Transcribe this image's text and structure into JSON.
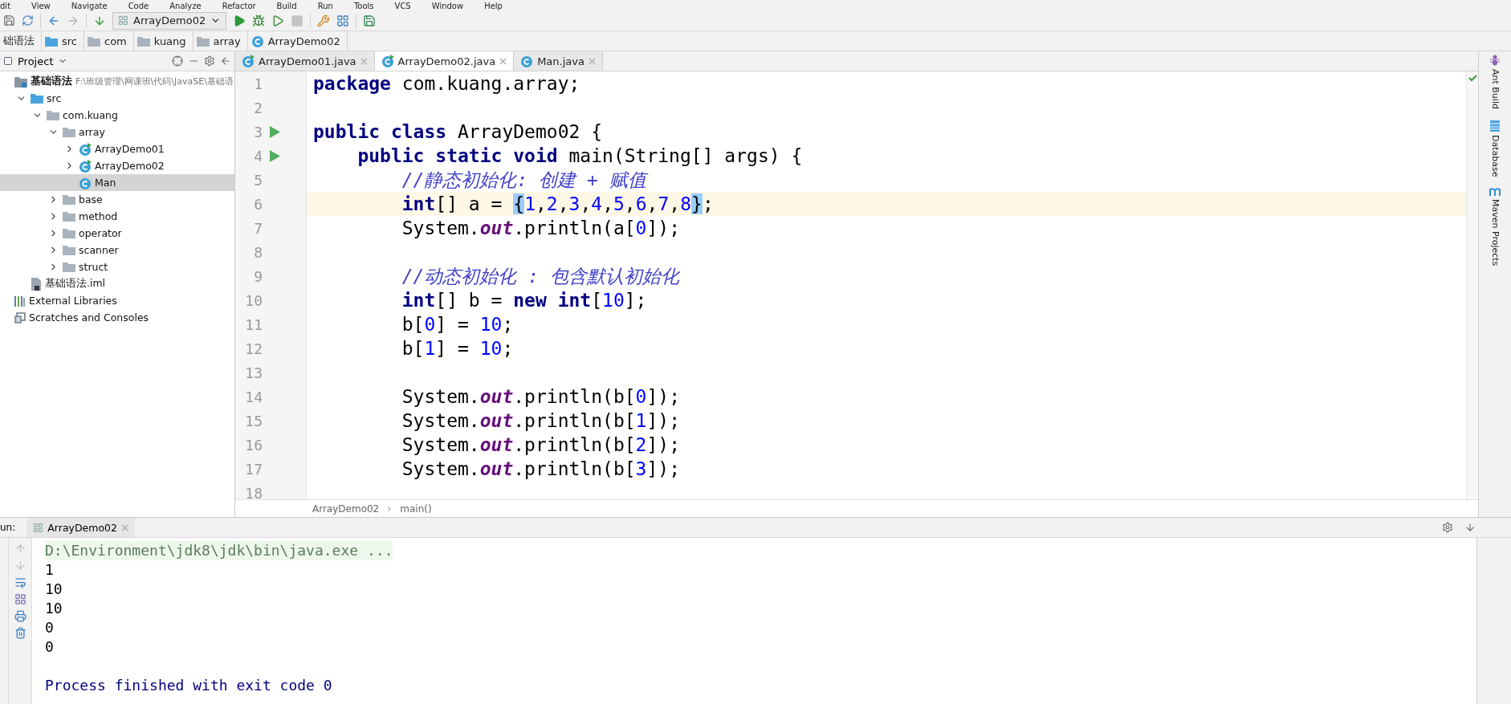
{
  "menu": [
    "dit",
    "View",
    "Navigate",
    "Code",
    "Analyze",
    "Refactor",
    "Build",
    "Run",
    "Tools",
    "VCS",
    "Window",
    "Help"
  ],
  "toolbar": {
    "run_config": "ArrayDemo02"
  },
  "breadcrumb": [
    {
      "label": "础语法"
    },
    {
      "label": "src",
      "kind": "source"
    },
    {
      "label": "com",
      "kind": "folder"
    },
    {
      "label": "kuang",
      "kind": "folder"
    },
    {
      "label": "array",
      "kind": "folder"
    },
    {
      "label": "ArrayDemo02",
      "kind": "class"
    }
  ],
  "project": {
    "title": "Project",
    "tree": [
      {
        "label": "基础语法",
        "path": "F:\\班级管理\\网课班\\代码\\JavaSE\\基础语",
        "kind": "module",
        "selected": false,
        "children": [
          {
            "label": "src",
            "kind": "source",
            "expanded": true,
            "selected": false,
            "children": [
              {
                "label": "com.kuang",
                "kind": "folder",
                "expanded": true,
                "selected": false,
                "children": [
                  {
                    "label": "array",
                    "kind": "folder",
                    "expanded": true,
                    "selected": false,
                    "children": [
                      {
                        "label": "ArrayDemo01",
                        "kind": "runclass",
                        "expanded": false,
                        "selected": false
                      },
                      {
                        "label": "ArrayDemo02",
                        "kind": "runclass",
                        "expanded": false,
                        "selected": false
                      },
                      {
                        "label": "Man",
                        "kind": "class",
                        "selected": true
                      }
                    ]
                  },
                  {
                    "label": "base",
                    "kind": "folder",
                    "expanded": false,
                    "selected": false
                  },
                  {
                    "label": "method",
                    "kind": "folder",
                    "expanded": false,
                    "selected": false
                  },
                  {
                    "label": "operator",
                    "kind": "folder",
                    "expanded": false,
                    "selected": false
                  },
                  {
                    "label": "scanner",
                    "kind": "folder",
                    "expanded": false,
                    "selected": false
                  },
                  {
                    "label": "struct",
                    "kind": "folder",
                    "expanded": false,
                    "selected": false
                  }
                ]
              }
            ]
          },
          {
            "label": "基础语法.iml",
            "kind": "file",
            "selected": false
          }
        ]
      },
      {
        "label": "External Libraries",
        "kind": "libraries",
        "selected": false
      },
      {
        "label": "Scratches and Consoles",
        "kind": "scratches",
        "selected": false
      }
    ]
  },
  "tabs": [
    {
      "label": "ArrayDemo01.java",
      "kind": "runclass",
      "selected": false
    },
    {
      "label": "ArrayDemo02.java",
      "kind": "runclass",
      "selected": true
    },
    {
      "label": "Man.java",
      "kind": "class",
      "selected": false
    }
  ],
  "code": [
    {
      "number": "1",
      "current": false,
      "run_marker": false,
      "tokens": [
        {
          "kind": "kw",
          "text": "package"
        },
        {
          "kind": "plain",
          "text": " com.kuang.array;"
        }
      ]
    },
    {
      "number": "2",
      "current": false,
      "run_marker": false
    },
    {
      "number": "3",
      "current": false,
      "run_marker": true,
      "tokens": [
        {
          "kind": "kw",
          "text": "public class"
        },
        {
          "kind": "plain",
          "text": " ArrayDemo02 {"
        }
      ]
    },
    {
      "number": "4",
      "current": false,
      "run_marker": true,
      "tokens": [
        {
          "kind": "kw",
          "text": "    public static void"
        },
        {
          "kind": "plain",
          "text": " main(String[] args) {"
        }
      ]
    },
    {
      "number": "5",
      "current": false,
      "run_marker": false,
      "tokens": [
        {
          "kind": "comment",
          "text": "        //静态初始化: 创建 + 赋值"
        }
      ]
    },
    {
      "number": "6",
      "current": true,
      "run_marker": false,
      "tokens": [
        {
          "kind": "kw",
          "text": "        int"
        },
        {
          "kind": "plain",
          "text": "[] a = "
        },
        {
          "kind": "brace",
          "text": "{"
        },
        {
          "kind": "num",
          "text": "1"
        },
        {
          "kind": "plain",
          "text": ","
        },
        {
          "kind": "num",
          "text": "2"
        },
        {
          "kind": "plain",
          "text": ","
        },
        {
          "kind": "num",
          "text": "3"
        },
        {
          "kind": "plain",
          "text": ","
        },
        {
          "kind": "num",
          "text": "4"
        },
        {
          "kind": "plain",
          "text": ","
        },
        {
          "kind": "num",
          "text": "5"
        },
        {
          "kind": "plain",
          "text": ","
        },
        {
          "kind": "num",
          "text": "6"
        },
        {
          "kind": "plain",
          "text": ","
        },
        {
          "kind": "num",
          "text": "7"
        },
        {
          "kind": "plain",
          "text": ","
        },
        {
          "kind": "num",
          "text": "8"
        },
        {
          "kind": "brace",
          "text": "}"
        },
        {
          "kind": "plain",
          "text": ";"
        }
      ]
    },
    {
      "number": "7",
      "current": false,
      "run_marker": false,
      "tokens": [
        {
          "kind": "plain",
          "text": "        System."
        },
        {
          "kind": "field",
          "text": "out"
        },
        {
          "kind": "plain",
          "text": ".println(a["
        },
        {
          "kind": "num",
          "text": "0"
        },
        {
          "kind": "plain",
          "text": "]);"
        }
      ]
    },
    {
      "number": "8",
      "current": false,
      "run_marker": false
    },
    {
      "number": "9",
      "current": false,
      "run_marker": false,
      "tokens": [
        {
          "kind": "comment",
          "text": "        //动态初始化 : 包含默认初始化"
        }
      ]
    },
    {
      "number": "10",
      "current": false,
      "run_marker": false,
      "tokens": [
        {
          "kind": "kw",
          "text": "        int"
        },
        {
          "kind": "plain",
          "text": "[] b = "
        },
        {
          "kind": "kw",
          "text": "new int"
        },
        {
          "kind": "plain",
          "text": "["
        },
        {
          "kind": "num",
          "text": "10"
        },
        {
          "kind": "plain",
          "text": "];"
        }
      ]
    },
    {
      "number": "11",
      "current": false,
      "run_marker": false,
      "tokens": [
        {
          "kind": "plain",
          "text": "        b["
        },
        {
          "kind": "num",
          "text": "0"
        },
        {
          "kind": "plain",
          "text": "] = "
        },
        {
          "kind": "num",
          "text": "10"
        },
        {
          "kind": "plain",
          "text": ";"
        }
      ]
    },
    {
      "number": "12",
      "current": false,
      "run_marker": false,
      "tokens": [
        {
          "kind": "plain",
          "text": "        b["
        },
        {
          "kind": "num",
          "text": "1"
        },
        {
          "kind": "plain",
          "text": "] = "
        },
        {
          "kind": "num",
          "text": "10"
        },
        {
          "kind": "plain",
          "text": ";"
        }
      ]
    },
    {
      "number": "13",
      "current": false,
      "run_marker": false
    },
    {
      "number": "14",
      "current": false,
      "run_marker": false,
      "tokens": [
        {
          "kind": "plain",
          "text": "        System."
        },
        {
          "kind": "field",
          "text": "out"
        },
        {
          "kind": "plain",
          "text": ".println(b["
        },
        {
          "kind": "num",
          "text": "0"
        },
        {
          "kind": "plain",
          "text": "]);"
        }
      ]
    },
    {
      "number": "15",
      "current": false,
      "run_marker": false,
      "tokens": [
        {
          "kind": "plain",
          "text": "        System."
        },
        {
          "kind": "field",
          "text": "out"
        },
        {
          "kind": "plain",
          "text": ".println(b["
        },
        {
          "kind": "num",
          "text": "1"
        },
        {
          "kind": "plain",
          "text": "]);"
        }
      ]
    },
    {
      "number": "16",
      "current": false,
      "run_marker": false,
      "tokens": [
        {
          "kind": "plain",
          "text": "        System."
        },
        {
          "kind": "field",
          "text": "out"
        },
        {
          "kind": "plain",
          "text": ".println(b["
        },
        {
          "kind": "num",
          "text": "2"
        },
        {
          "kind": "plain",
          "text": "]);"
        }
      ]
    },
    {
      "number": "17",
      "current": false,
      "run_marker": false,
      "tokens": [
        {
          "kind": "plain",
          "text": "        System."
        },
        {
          "kind": "field",
          "text": "out"
        },
        {
          "kind": "plain",
          "text": ".println(b["
        },
        {
          "kind": "num",
          "text": "3"
        },
        {
          "kind": "plain",
          "text": "]);"
        }
      ]
    },
    {
      "number": "18",
      "current": false,
      "run_marker": false
    }
  ],
  "editor_breadcrumb": [
    "ArrayDemo02",
    "main()"
  ],
  "right_sidebar": [
    {
      "label": "Ant Build",
      "kind": "ant"
    },
    {
      "label": "Database",
      "kind": "database"
    },
    {
      "label": "Maven Projects",
      "kind": "maven"
    }
  ],
  "run": {
    "label": "un:",
    "tab": "ArrayDemo02",
    "console": [
      {
        "kind": "command",
        "text": "D:\\Environment\\jdk8\\jdk\\bin\\java.exe ..."
      },
      {
        "kind": "output",
        "text": "1"
      },
      {
        "kind": "output",
        "text": "10"
      },
      {
        "kind": "output",
        "text": "10"
      },
      {
        "kind": "output",
        "text": "0"
      },
      {
        "kind": "output",
        "text": "0"
      },
      {
        "kind": "exit",
        "text": "Process finished with exit code 0"
      }
    ]
  }
}
